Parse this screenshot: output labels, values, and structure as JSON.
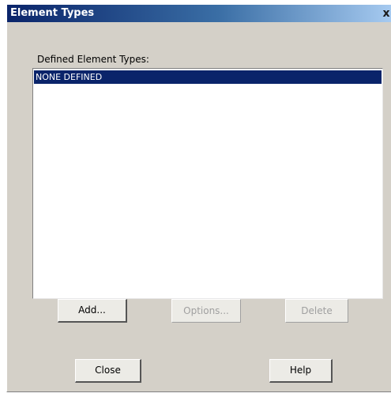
{
  "window": {
    "title": "Element Types",
    "close_glyph": "x"
  },
  "list": {
    "label": "Defined Element Types:",
    "items": [
      "NONE DEFINED"
    ],
    "selected_index": 0
  },
  "buttons": {
    "add": "Add...",
    "options": "Options...",
    "delete": "Delete",
    "close": "Close",
    "help": "Help"
  },
  "colors": {
    "selection": "#0a246a",
    "dialog_bg": "#d4d0c8",
    "title_start": "#0a246a",
    "title_end": "#a6caf0"
  }
}
